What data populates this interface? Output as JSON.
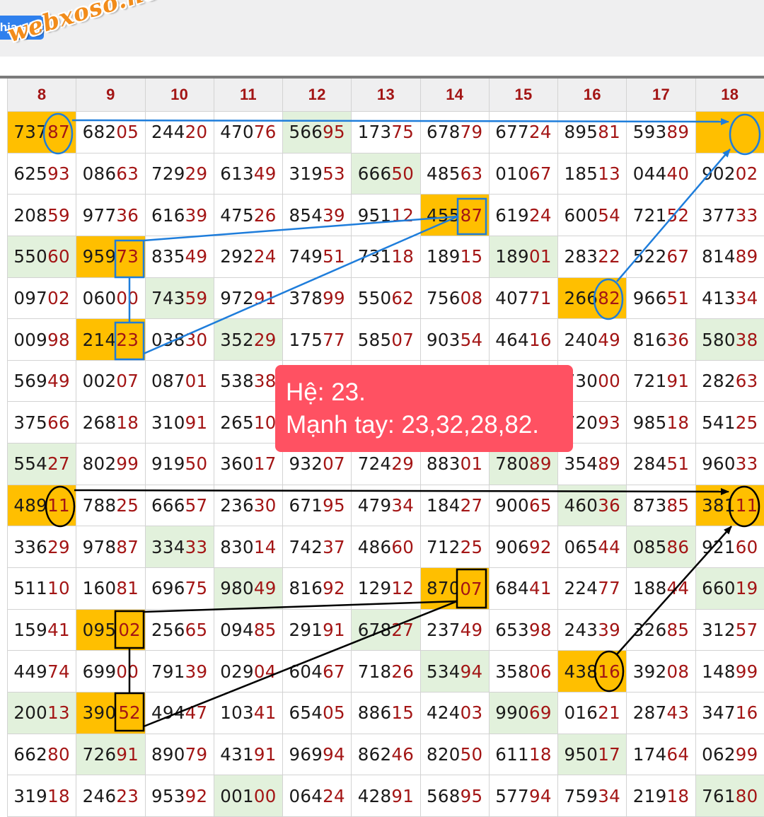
{
  "header": {
    "share_label": "hia sẻ",
    "watermark": "webxoso.net"
  },
  "columns": [
    "8",
    "9",
    "10",
    "11",
    "12",
    "13",
    "14",
    "15",
    "16",
    "17",
    "18"
  ],
  "rows": [
    [
      "73787",
      "68205",
      "24420",
      "47076",
      "56695",
      "17375",
      "67879",
      "67724",
      "89581",
      "59389",
      ""
    ],
    [
      "62593",
      "08663",
      "72929",
      "61349",
      "31953",
      "66650",
      "48563",
      "01067",
      "18513",
      "04440",
      "90202"
    ],
    [
      "20859",
      "97736",
      "61639",
      "47526",
      "85439",
      "95112",
      "45587",
      "61924",
      "60054",
      "72152",
      "37733"
    ],
    [
      "55060",
      "95973",
      "83549",
      "29224",
      "74951",
      "73118",
      "18915",
      "18901",
      "28322",
      "52267",
      "81489"
    ],
    [
      "09702",
      "06000",
      "74359",
      "97291",
      "37899",
      "55062",
      "75608",
      "40771",
      "26682",
      "96651",
      "41334"
    ],
    [
      "00998",
      "21423",
      "03830",
      "35229",
      "17577",
      "58507",
      "90354",
      "46416",
      "24049",
      "81636",
      "58038"
    ],
    [
      "56949",
      "00207",
      "08701",
      "53838",
      "",
      "",
      "",
      "",
      "73000",
      "72191",
      "28263"
    ],
    [
      "37566",
      "26818",
      "31091",
      "26510",
      "",
      "",
      "",
      "",
      "72093",
      "98518",
      "54125"
    ],
    [
      "55427",
      "80299",
      "91950",
      "36017",
      "93207",
      "72429",
      "88301",
      "78089",
      "35489",
      "28451",
      "96033"
    ],
    [
      "48911",
      "78825",
      "66657",
      "23630",
      "67195",
      "47934",
      "18427",
      "90065",
      "46036",
      "87385",
      "38111"
    ],
    [
      "33629",
      "97887",
      "33433",
      "83014",
      "74237",
      "48660",
      "71225",
      "90692",
      "06544",
      "08586",
      "92160"
    ],
    [
      "51110",
      "16081",
      "69675",
      "98049",
      "81692",
      "12912",
      "87007",
      "68441",
      "22477",
      "18844",
      "66019"
    ],
    [
      "15941",
      "09502",
      "25665",
      "09485",
      "29191",
      "67827",
      "23749",
      "65398",
      "24339",
      "32685",
      "31257"
    ],
    [
      "44974",
      "69900",
      "79139",
      "02904",
      "60467",
      "71826",
      "53494",
      "35806",
      "43816",
      "39208",
      "14899"
    ],
    [
      "20013",
      "39052",
      "49447",
      "10341",
      "65405",
      "88615",
      "42403",
      "99069",
      "01621",
      "28743",
      "34716"
    ],
    [
      "66280",
      "72691",
      "89079",
      "43191",
      "96994",
      "86246",
      "82050",
      "61118",
      "95017",
      "17464",
      "06299"
    ],
    [
      "31918",
      "24623",
      "95392",
      "00100",
      "06424",
      "42891",
      "56895",
      "57794",
      "75934",
      "21918",
      "76180"
    ]
  ],
  "highlights": {
    "orange": [
      [
        0,
        0
      ],
      [
        0,
        10
      ],
      [
        2,
        6
      ],
      [
        3,
        1
      ],
      [
        4,
        8
      ],
      [
        5,
        1
      ],
      [
        9,
        0
      ],
      [
        9,
        10
      ],
      [
        11,
        6
      ],
      [
        12,
        1
      ],
      [
        13,
        8
      ],
      [
        14,
        1
      ]
    ],
    "green": [
      [
        0,
        4
      ],
      [
        1,
        5
      ],
      [
        3,
        0
      ],
      [
        3,
        7
      ],
      [
        4,
        2
      ],
      [
        5,
        3
      ],
      [
        5,
        10
      ],
      [
        8,
        0
      ],
      [
        8,
        7
      ],
      [
        9,
        8
      ],
      [
        10,
        2
      ],
      [
        10,
        9
      ],
      [
        11,
        3
      ],
      [
        11,
        10
      ],
      [
        12,
        5
      ],
      [
        13,
        6
      ],
      [
        14,
        0
      ],
      [
        14,
        7
      ],
      [
        15,
        1
      ],
      [
        15,
        8
      ],
      [
        16,
        3
      ],
      [
        16,
        10
      ]
    ]
  },
  "callout": {
    "line1": "Hệ: 23.",
    "line2": "Mạnh tay: 23,32,28,82."
  },
  "colors": {
    "accent_red": "#a31515",
    "orange": "#ffbf00",
    "green": "#e2f1dc",
    "blue_line": "#1e7ddb",
    "black_line": "#000000",
    "callout_bg": "#ff5162",
    "share_btn": "#2f80ed"
  }
}
